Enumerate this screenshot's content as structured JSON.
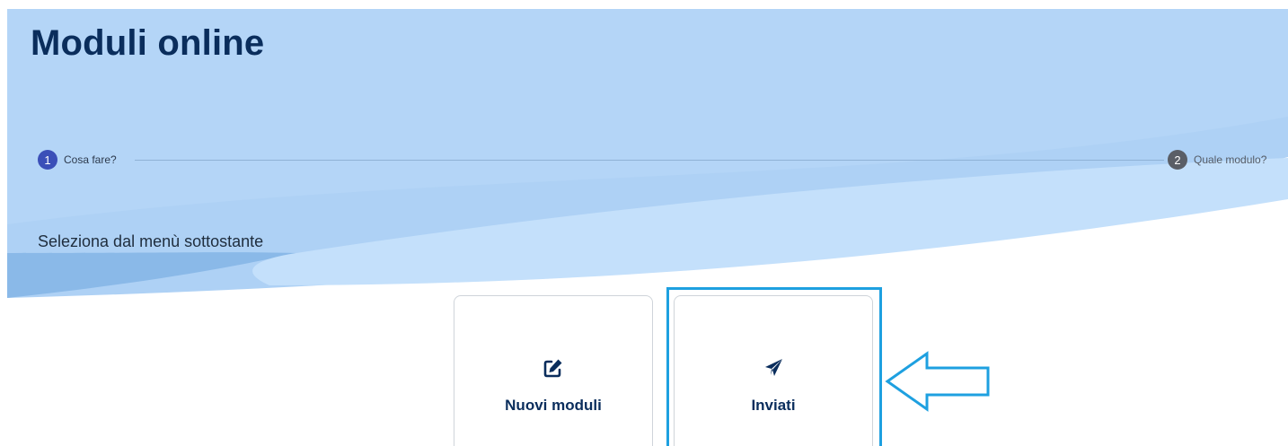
{
  "page": {
    "title": "Moduli online",
    "instruction": "Seleziona dal menù sottostante"
  },
  "stepper": {
    "steps": [
      {
        "number": "1",
        "label": "Cosa fare?",
        "state": "active"
      },
      {
        "number": "2",
        "label": "Quale modulo?",
        "state": "inactive"
      }
    ]
  },
  "tiles": [
    {
      "label": "Nuovi moduli",
      "icon": "edit-icon"
    },
    {
      "label": "Inviati",
      "icon": "paper-plane-icon"
    }
  ],
  "colors": {
    "title": "#0a2d5c",
    "hero_light": "#c4e0fb",
    "hero_mid": "#aed1f5",
    "hero_dark": "#8ab9e8",
    "step_active": "#3b4fb8",
    "step_inactive": "#5a5e66",
    "highlight": "#1ea0e0"
  }
}
